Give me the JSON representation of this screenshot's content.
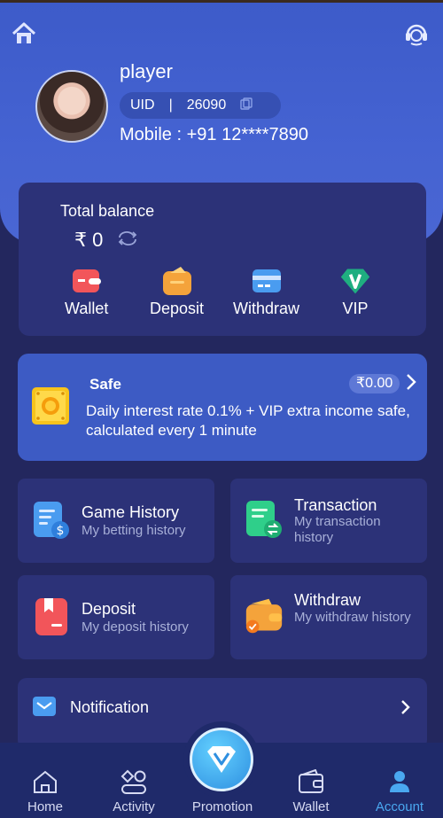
{
  "profile": {
    "username": "player",
    "uid_label": "UID",
    "uid_separator": "|",
    "uid_value": "26090",
    "mobile": "Mobile : +91 12****7890"
  },
  "balance": {
    "title": "Total balance",
    "value": "₹ 0",
    "actions": [
      {
        "label": "Wallet",
        "icon": "wallet-icon",
        "color": "#f2555a"
      },
      {
        "label": "Deposit",
        "icon": "deposit-icon",
        "color": "#f4a33b"
      },
      {
        "label": "Withdraw",
        "icon": "withdraw-icon",
        "color": "#4a9cf0"
      },
      {
        "label": "VIP",
        "icon": "vip-icon",
        "color": "#1fae80"
      }
    ]
  },
  "safe": {
    "title": "Safe",
    "amount": "₹0.00",
    "description": "Daily interest rate 0.1% + VIP extra income safe, calculated every 1 minute"
  },
  "tiles": [
    {
      "title": "Game History",
      "subtitle": "My betting history",
      "icon": "game-history-icon",
      "color": "#4a9cf0"
    },
    {
      "title": "Transaction",
      "subtitle": "My transaction history",
      "icon": "transaction-icon",
      "color": "#2fcf8a"
    },
    {
      "title": "Deposit",
      "subtitle": "My deposit history",
      "icon": "deposit-history-icon",
      "color": "#f2555a"
    },
    {
      "title": "Withdraw",
      "subtitle": "My withdraw history",
      "icon": "withdraw-history-icon",
      "color": "#f4a33b"
    }
  ],
  "notification": {
    "label": "Notification"
  },
  "nav": {
    "items": [
      {
        "label": "Home",
        "icon": "home-icon"
      },
      {
        "label": "Activity",
        "icon": "activity-icon"
      },
      {
        "label": "Promotion",
        "icon": "promotion-icon"
      },
      {
        "label": "Wallet",
        "icon": "wallet-icon"
      },
      {
        "label": "Account",
        "icon": "account-icon"
      }
    ],
    "active": "Account"
  },
  "colors": {
    "background": "#23275e",
    "header": "#4563d2",
    "card": "#2c3278",
    "accent": "#4aa8f0"
  }
}
